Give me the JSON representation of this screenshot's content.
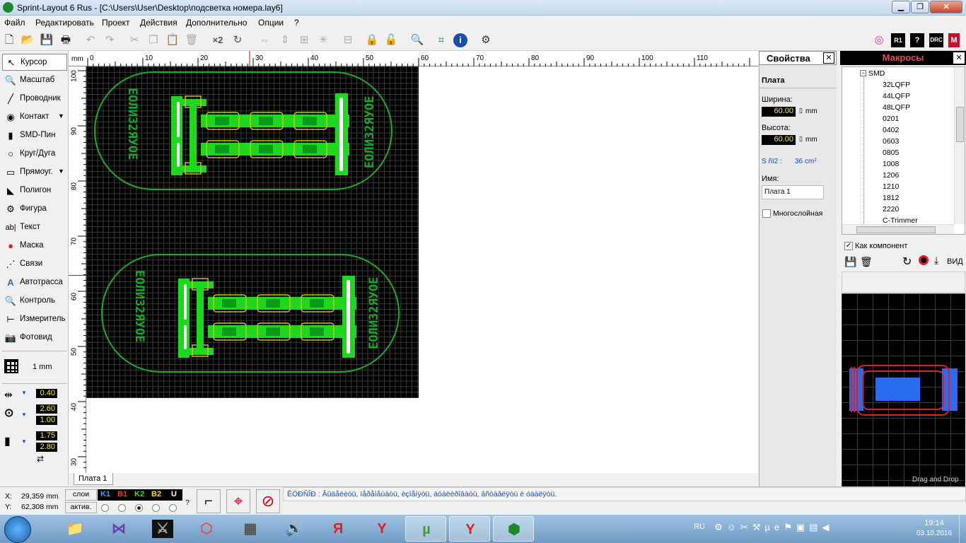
{
  "window": {
    "title": "Sprint-Layout 6 Rus - [C:\\Users\\User\\Desktop\\подсветка номера.lay6]",
    "min": "▁",
    "max": "❐",
    "close": "✕"
  },
  "menu": [
    "Файл",
    "Редактировать",
    "Проект",
    "Действия",
    "Дополнительно",
    "Опции",
    "?"
  ],
  "toolbar": {
    "x2": "×2"
  },
  "tools": [
    {
      "name": "cursor",
      "label": "Курсор",
      "icon": "↖"
    },
    {
      "name": "zoom",
      "label": "Масштаб",
      "icon": "🔍"
    },
    {
      "name": "track",
      "label": "Проводник",
      "icon": "╱"
    },
    {
      "name": "pad",
      "label": "Контакт",
      "icon": "●"
    },
    {
      "name": "smd",
      "label": "SMD-Пин",
      "icon": "▮"
    },
    {
      "name": "circle",
      "label": "Круг/Дуга",
      "icon": "○"
    },
    {
      "name": "rect",
      "label": "Прямоуг.",
      "icon": "▭"
    },
    {
      "name": "polygon",
      "label": "Полигон",
      "icon": "◣"
    },
    {
      "name": "figure",
      "label": "Фигура",
      "icon": "⚙"
    },
    {
      "name": "text",
      "label": "Текст",
      "icon": "ab|"
    },
    {
      "name": "mask",
      "label": "Маска",
      "icon": "●"
    },
    {
      "name": "connections",
      "label": "Связи",
      "icon": "⋰"
    },
    {
      "name": "autoroute",
      "label": "Автотрасса",
      "icon": "A"
    },
    {
      "name": "control",
      "label": "Контроль",
      "icon": "🔍"
    },
    {
      "name": "measure",
      "label": "Измеритель",
      "icon": "⊢"
    },
    {
      "name": "photo",
      "label": "Фотовид",
      "icon": "📷"
    }
  ],
  "grid": {
    "label": "1 mm"
  },
  "values": {
    "track_width": "0.40",
    "pad_outer": "2.60",
    "pad_inner": "1.00",
    "smd_w": "1.75",
    "smd_h": "2.80"
  },
  "ruler": {
    "unit": "mm",
    "top": [
      "0",
      "10",
      "20",
      "30",
      "40",
      "50",
      "60",
      "70",
      "80",
      "90",
      "100",
      "110"
    ],
    "left": [
      "100",
      "90",
      "80",
      "70",
      "60",
      "50",
      "40",
      "30"
    ]
  },
  "board": {
    "text": "ЕОЛИ32ЯУОЕ"
  },
  "tab": "Плата 1",
  "properties": {
    "header": "Свойства",
    "close": "✕",
    "section": "Плата",
    "width_label": "Ширина:",
    "width_value": "60.00",
    "width_unit": "mm",
    "height_label": "Высота:",
    "height_value": "60.00",
    "height_unit": "mm",
    "area_label": "S ñï2 :",
    "area_value": "36 cm²",
    "name_label": "Имя:",
    "name_value": "Плата 1",
    "multilayer_label": "Многослойная"
  },
  "macros": {
    "header": "Макросы",
    "close": "✕",
    "root": "SMD",
    "items": [
      "32LQFP",
      "44LQFP",
      "48LQFP",
      "0201",
      "0402",
      "0603",
      "0805",
      "1008",
      "1206",
      "1210",
      "1812",
      "2220",
      "C-Trimmer"
    ],
    "as_component": "Как компонент",
    "view": "ВИД",
    "drag_drop": "Drag and Drop"
  },
  "status": {
    "x_label": "X:",
    "x_value": "29,359 mm",
    "y_label": "Y:",
    "y_value": "62,308 mm",
    "layers_label": "слои",
    "active_label": "актив.",
    "layers": [
      {
        "name": "K1",
        "color": "#3aa0ff"
      },
      {
        "name": "B1",
        "color": "#ff3030"
      },
      {
        "name": "K2",
        "color": "#30e030"
      },
      {
        "name": "B2",
        "color": "#ffd700"
      },
      {
        "name": "U",
        "color": "#ffffff"
      }
    ],
    "question": "?",
    "message": "ÊÓÐÑÎÐ : Âûäåëèòü, ïåðåìåùàòü, èçìåíÿòü, äóáëèðîâàòü, âñòàâëÿòü è óäàëÿòü."
  },
  "taskbar": {
    "lang": "RU",
    "time": "19:14",
    "date": "03.10.2016"
  }
}
